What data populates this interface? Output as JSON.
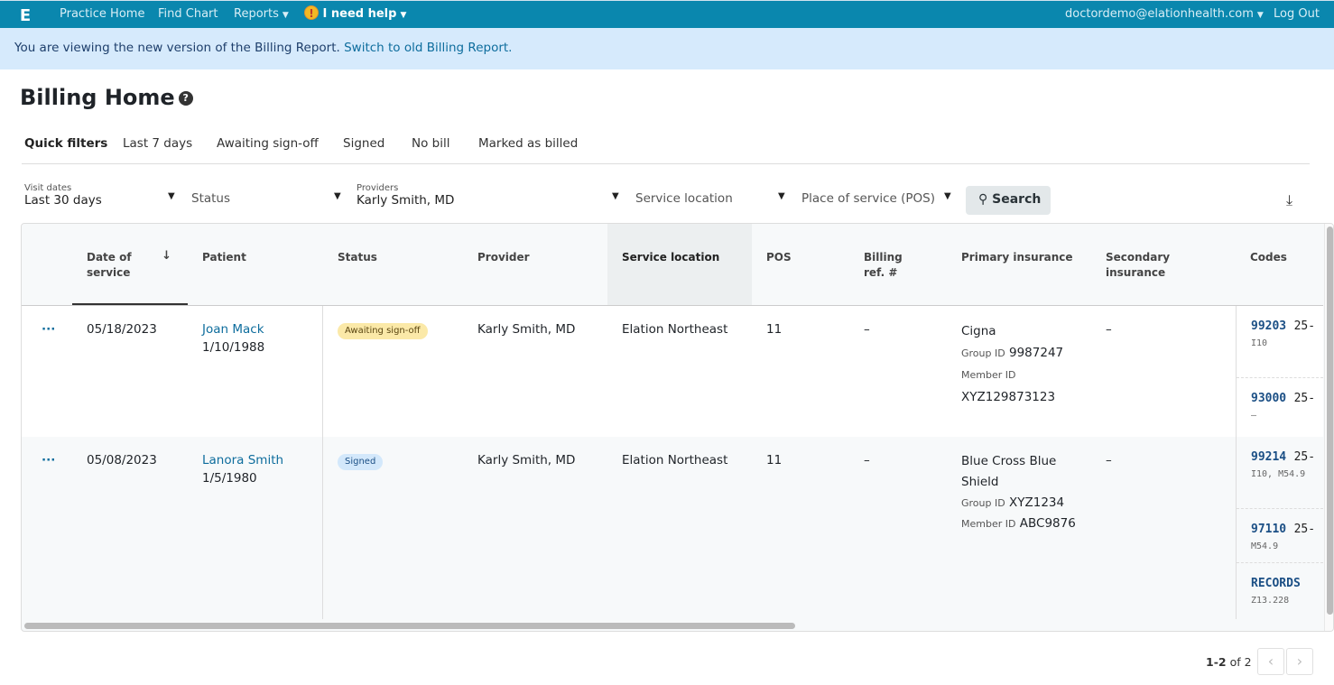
{
  "nav": {
    "logo": "E",
    "items": [
      "Practice Home",
      "Find Chart",
      "Reports"
    ],
    "help": "I need help",
    "user": "doctordemo@elationhealth.com",
    "logout": "Log Out"
  },
  "banner": {
    "text": "You are viewing the new version of the Billing Report.",
    "link": "Switch to old Billing Report."
  },
  "page": {
    "title": "Billing Home"
  },
  "quick_filters": {
    "label": "Quick filters",
    "items": [
      "Last 7 days",
      "Awaiting sign-off",
      "Signed",
      "No bill",
      "Marked as billed"
    ]
  },
  "filters": {
    "visit_dates_label": "Visit dates",
    "visit_dates": "Last 30 days",
    "status": "Status",
    "providers_label": "Providers",
    "providers": "Karly Smith, MD",
    "service_location": "Service location",
    "pos": "Place of service (POS)",
    "search": "Search"
  },
  "table": {
    "columns": [
      "Date of service",
      "Patient",
      "Status",
      "Provider",
      "Service location",
      "POS",
      "Billing ref. #",
      "Primary insurance",
      "Secondary insurance",
      "Codes"
    ],
    "sort_icon": "arrow-down-icon",
    "rows": [
      {
        "date": "05/18/2023",
        "patient": "Joan Mack",
        "dob": "1/10/1988",
        "status": "Awaiting sign-off",
        "provider": "Karly Smith, MD",
        "location": "Elation Northeast",
        "pos": "11",
        "billing_ref": "–",
        "insurer": "Cigna",
        "group_label": "Group ID",
        "group_id": "9987247",
        "member_label": "Member ID",
        "member_id": "XYZ129873123",
        "secondary": "–",
        "codes": [
          {
            "cpt": "99203",
            "mod": "25-",
            "dx": "I10"
          },
          {
            "cpt": "93000",
            "mod": "25-",
            "dx": "–"
          }
        ]
      },
      {
        "date": "05/08/2023",
        "patient": "Lanora Smith",
        "dob": "1/5/1980",
        "status": "Signed",
        "provider": "Karly Smith, MD",
        "location": "Elation Northeast",
        "pos": "11",
        "billing_ref": "–",
        "insurer": "Blue Cross Blue Shield",
        "group_label": "Group ID",
        "group_id": "XYZ1234",
        "member_label": "Member ID",
        "member_id": "ABC9876",
        "secondary": "–",
        "codes": [
          {
            "cpt": "99214",
            "mod": "25-",
            "dx": "I10, M54.9"
          },
          {
            "cpt": "97110",
            "mod": "25-",
            "dx": "M54.9"
          },
          {
            "cpt": "RECORDS",
            "mod": "",
            "dx": "Z13.228"
          }
        ]
      }
    ]
  },
  "pagination": {
    "range": "1-2",
    "of": "of 2"
  },
  "colors": {
    "nav": "#0a87ae",
    "banner": "#d6eafc",
    "link": "#0e6d9d",
    "awaiting": "#fbe9a8",
    "signed": "#d3e8fb"
  }
}
